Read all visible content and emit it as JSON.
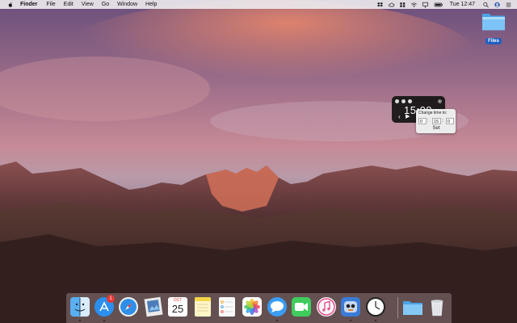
{
  "menubar": {
    "app_name": "Finder",
    "items": [
      "File",
      "Edit",
      "View",
      "Go",
      "Window",
      "Help"
    ],
    "clock": "Tue 12:47",
    "status_icons": [
      "dropbox-icon",
      "cloud-icon",
      "grid-icon",
      "wifi-icon",
      "airplay-icon",
      "battery-icon",
      "spotlight-icon",
      "user-icon",
      "notification-center-icon"
    ]
  },
  "desktop": {
    "files_icon_label": "Files"
  },
  "timer_widget": {
    "time_display": "15:00",
    "popover_title": "Change time to:",
    "hours": "0",
    "minutes": "15",
    "seconds": "0",
    "separator": ":",
    "set_label": "Set",
    "prev_glyph": "‹",
    "play_glyph": "▶"
  },
  "dock": {
    "apps": [
      "finder",
      "app-store",
      "safari",
      "preview",
      "calendar",
      "notes",
      "reminders",
      "photos",
      "messages",
      "facetime",
      "itunes",
      "tweetbot",
      "clock",
      "downloads-folder",
      "trash"
    ],
    "app_store_badge": "1",
    "calendar_month": "OCT",
    "calendar_day": "25"
  }
}
